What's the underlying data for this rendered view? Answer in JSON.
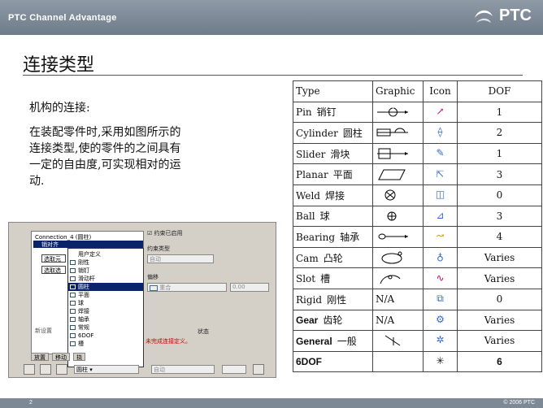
{
  "header": {
    "brand": "PTC Channel Advantage",
    "logo": "PTC"
  },
  "title": "连接类型",
  "body": {
    "p1": "机构的连接:",
    "p2": "在装配零件时,采用如图所示的连接类型,使的零件的之间具有一定的自由度,可实现相对的运动."
  },
  "dialog": {
    "tree_node": "Connection_4 (圆柱)",
    "tree_selected": "销对齐",
    "sub1": "选取元",
    "sub2": "选取选",
    "new_set": "新设置",
    "menu_items": [
      "用户定义",
      "刚性",
      "销钉",
      "滑动杆",
      "圆柱",
      "平面",
      "球",
      "焊接",
      "轴承",
      "常规",
      "6DOF",
      "槽"
    ],
    "highlighted": "圆柱",
    "checkbox_label": "约束已启用",
    "constraint_type_label": "约束类型",
    "constraint_type_value": "自动",
    "offset_label": "偏移",
    "offset_value": "重合",
    "offset_num": "0.00",
    "status_label": "状态",
    "status_value": "未完成连接定义。",
    "tabs": [
      "放置",
      "移动",
      "挠"
    ],
    "toolbar_type": "圆柱",
    "toolbar_mode": "自动"
  },
  "table": {
    "headers": [
      "Type",
      "Graphic",
      "Icon",
      "DOF"
    ],
    "rows": [
      {
        "type": "Pin",
        "zh": "销钉",
        "graphic": "",
        "dof": "1"
      },
      {
        "type": "Cylinder",
        "zh": "圆柱",
        "graphic": "",
        "dof": "2"
      },
      {
        "type": "Slider",
        "zh": "滑块",
        "graphic": "",
        "dof": "1"
      },
      {
        "type": "Planar",
        "zh": "平面",
        "graphic": "",
        "dof": "3"
      },
      {
        "type": "Weld",
        "zh": "焊接",
        "graphic": "",
        "dof": "0"
      },
      {
        "type": "Ball",
        "zh": "球",
        "graphic": "",
        "dof": "3"
      },
      {
        "type": "Bearing",
        "zh": "轴承",
        "graphic": "",
        "dof": "4"
      },
      {
        "type": "Cam",
        "zh": "凸轮",
        "graphic": "",
        "dof": "Varies"
      },
      {
        "type": "Slot",
        "zh": "槽",
        "graphic": "",
        "dof": "Varies"
      },
      {
        "type": "Rigid",
        "zh": "刚性",
        "graphic": "N/A",
        "dof": "0"
      },
      {
        "type": "Gear",
        "zh": "齿轮",
        "graphic": "N/A",
        "dof": "Varies"
      },
      {
        "type": "General",
        "zh": "一般",
        "graphic": "",
        "dof": "Varies"
      },
      {
        "type": "6DOF",
        "zh": "",
        "graphic": "",
        "dof": "6"
      }
    ]
  },
  "footer": {
    "page": "2",
    "copyright": "© 2006 PTC"
  }
}
